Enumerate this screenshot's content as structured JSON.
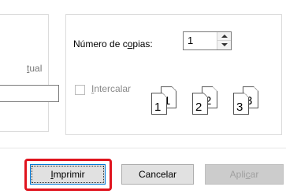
{
  "left_panel": {
    "actual_label_prefix": "",
    "actual_label_underlined": "t",
    "actual_label_rest": "ual"
  },
  "copies": {
    "label_before": "Número de c",
    "label_underlined": "o",
    "label_after": "pias:",
    "value": "1"
  },
  "collate": {
    "label_underlined": "I",
    "label_rest": "ntercalar",
    "checked": false,
    "enabled": false,
    "sheets": [
      "1",
      "1",
      "2",
      "2",
      "3",
      "3"
    ]
  },
  "buttons": {
    "print_underlined": "I",
    "print_rest": "mprimir",
    "cancel": "Cancelar",
    "apply_before": "Apli",
    "apply_underlined": "c",
    "apply_after": "ar"
  },
  "colors": {
    "highlight": "#e0141e",
    "focus_border": "#0078d7",
    "button_face": "#e1e1e1"
  }
}
